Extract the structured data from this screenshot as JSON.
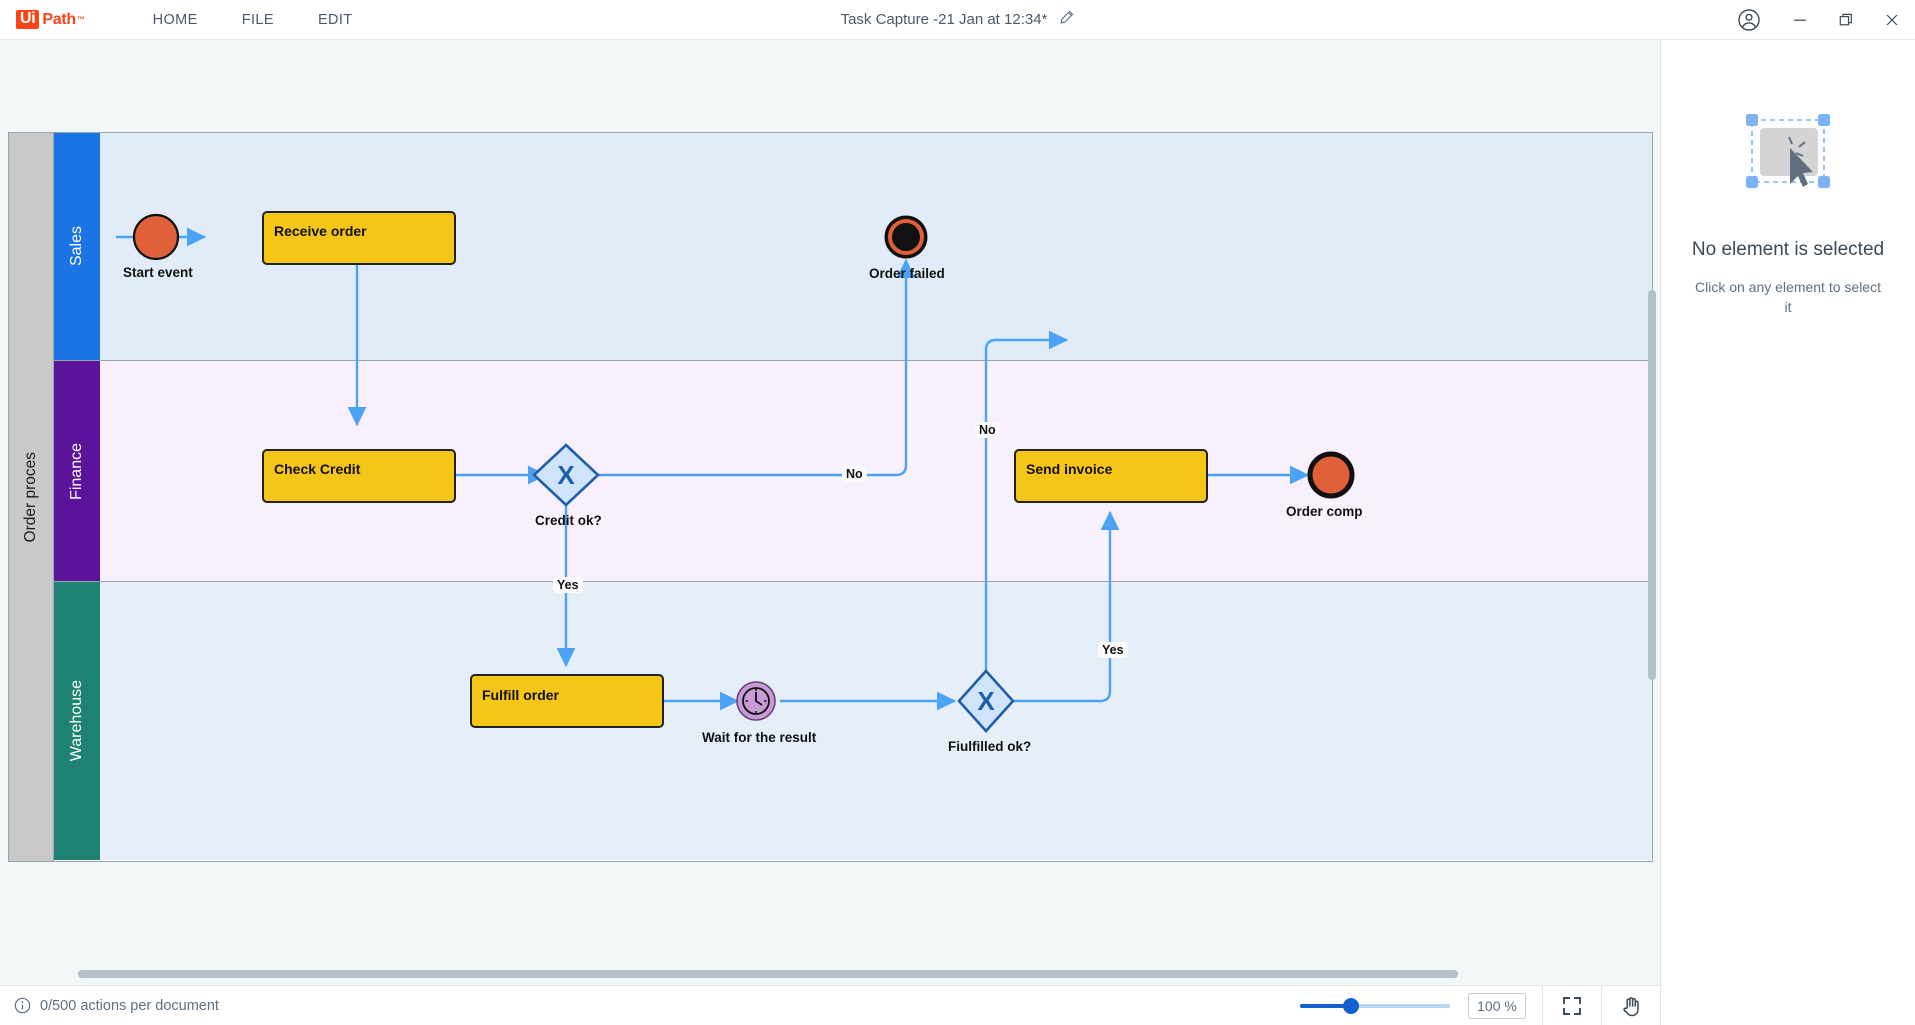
{
  "titlebar": {
    "logo_ui": "Ui",
    "logo_path": "Path",
    "logo_tm": "™",
    "menu": [
      {
        "label": "HOME"
      },
      {
        "label": "FILE"
      },
      {
        "label": "EDIT"
      }
    ],
    "document_title": "Task Capture -21 Jan at 12:34*",
    "edit_icon": "pencil-icon",
    "account_icon": "account-circle-icon",
    "minimize_icon": "minimize-icon",
    "restore_icon": "restore-icon",
    "close_icon": "close-icon"
  },
  "diagram": {
    "pool": {
      "label": "Order proces"
    },
    "lanes": [
      {
        "label": "Sales",
        "header_color": "#1b74e4",
        "body_color": "#e1ecf8"
      },
      {
        "label": "Finance",
        "header_color": "#5b139b",
        "body_color": "#f8f0fc"
      },
      {
        "label": "Warehouse",
        "header_color": "#1d8271",
        "body_color": "#e6eff8"
      }
    ],
    "nodes": [
      {
        "id": "start",
        "type": "start-event",
        "label": "Start event",
        "lane": "Sales"
      },
      {
        "id": "receive",
        "type": "task",
        "label": "Receive order",
        "lane": "Sales"
      },
      {
        "id": "order_failed",
        "type": "terminate-event",
        "label": "Order failed",
        "lane": "Sales"
      },
      {
        "id": "check_credit",
        "type": "task",
        "label": "Check Credit",
        "lane": "Finance"
      },
      {
        "id": "credit_gw",
        "type": "xor-gateway",
        "label": "Credit ok?",
        "lane": "Finance",
        "marker": "X"
      },
      {
        "id": "send_invoice",
        "type": "task",
        "label": "Send invoice",
        "lane": "Finance"
      },
      {
        "id": "order_comp",
        "type": "end-event",
        "label": "Order comp",
        "lane": "Finance"
      },
      {
        "id": "fulfill",
        "type": "task",
        "label": "Fulfill order",
        "lane": "Warehouse"
      },
      {
        "id": "wait",
        "type": "timer-event",
        "label": "Wait for the result",
        "lane": "Warehouse"
      },
      {
        "id": "fulfil_gw",
        "type": "xor-gateway",
        "label": "Fiulfilled ok?",
        "lane": "Warehouse",
        "marker": "X"
      }
    ],
    "flow_labels": [
      {
        "id": "credit_no",
        "text": "No"
      },
      {
        "id": "credit_yes",
        "text": "Yes"
      },
      {
        "id": "fulfil_no",
        "text": "No"
      },
      {
        "id": "fulfil_yes",
        "text": "Yes"
      }
    ],
    "colors": {
      "task_fill": "#f5c518",
      "task_stroke": "#222222",
      "gateway_fill": "#cfe4fb",
      "gateway_stroke": "#1f5fa8",
      "gateway_marker": "#1a5fa8",
      "event_fill": "#e0603a",
      "event_stroke": "#111111",
      "timer_fill": "#c89ad6",
      "connector": "#4aa3f5"
    }
  },
  "inspector": {
    "title": "No element is selected",
    "subtitle": "Click on any element to select it",
    "illustration": "selection-placeholder-icon"
  },
  "statusbar": {
    "info_icon": "info-icon",
    "actions_text": "0/500 actions per document",
    "zoom_value": "100 %",
    "fit_icon": "fit-to-screen-icon",
    "pan_icon": "pan-hand-icon"
  }
}
